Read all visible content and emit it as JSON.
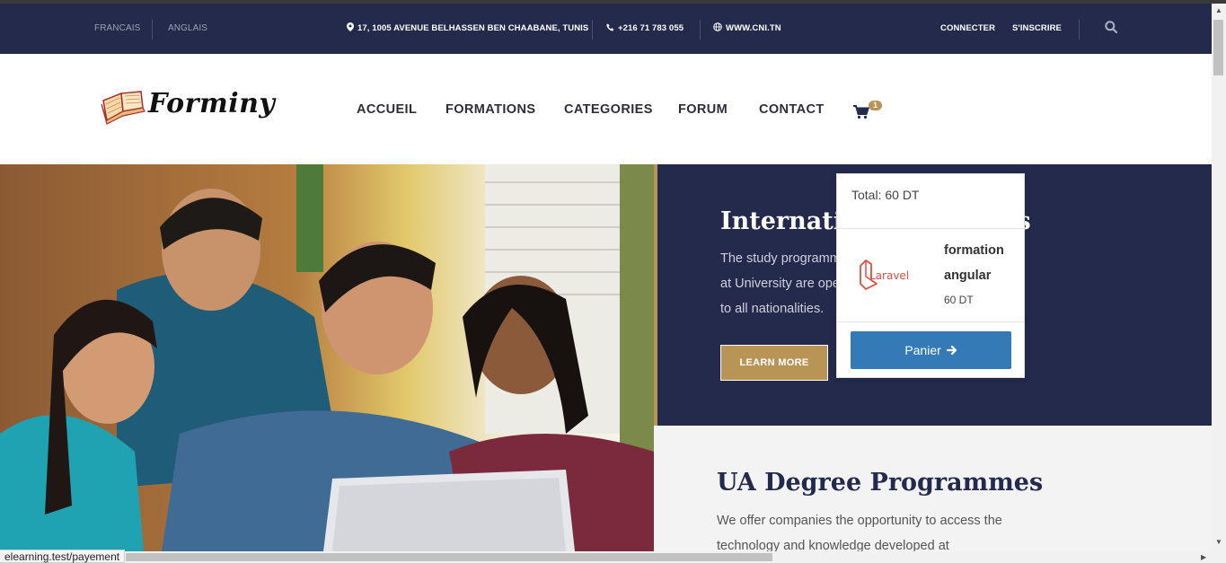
{
  "colors": {
    "navy": "#232a4b",
    "gold": "#b99457",
    "blue_button": "#337ab7"
  },
  "topbar": {
    "lang_fr": "FRANCAIS",
    "lang_en": "ANGLAIS",
    "address": "17, 1005 AVENUE BELHASSEN BEN CHAABANE, TUNIS",
    "phone": "+216 71 783 055",
    "website": "WWW.CNI.TN",
    "login": "CONNECTER",
    "register": "S'INSCRIRE",
    "icons": [
      "map-marker-icon",
      "phone-icon",
      "globe-icon",
      "search-icon"
    ]
  },
  "header": {
    "logo_text": "Forminy",
    "nav": [
      "ACCUEIL",
      "FORMATIONS",
      "CATEGORIES",
      "FORUM",
      "CONTACT"
    ],
    "cart_count": "1"
  },
  "hero": {
    "title": "International Students",
    "text": "The study programmes at University are open to all nationalities.",
    "button": "LEARN MORE"
  },
  "lower": {
    "title": "UA Degree Programmes",
    "text": "We offer companies the opportunity to access the technology and knowledge developed at"
  },
  "cart_popup": {
    "total": "Total: 60 DT",
    "item_name": "formation angular",
    "item_logo_text": "Laravel",
    "item_price": "60 DT",
    "button": "Panier"
  },
  "statusbar": {
    "url": "elearning.test/payement"
  }
}
